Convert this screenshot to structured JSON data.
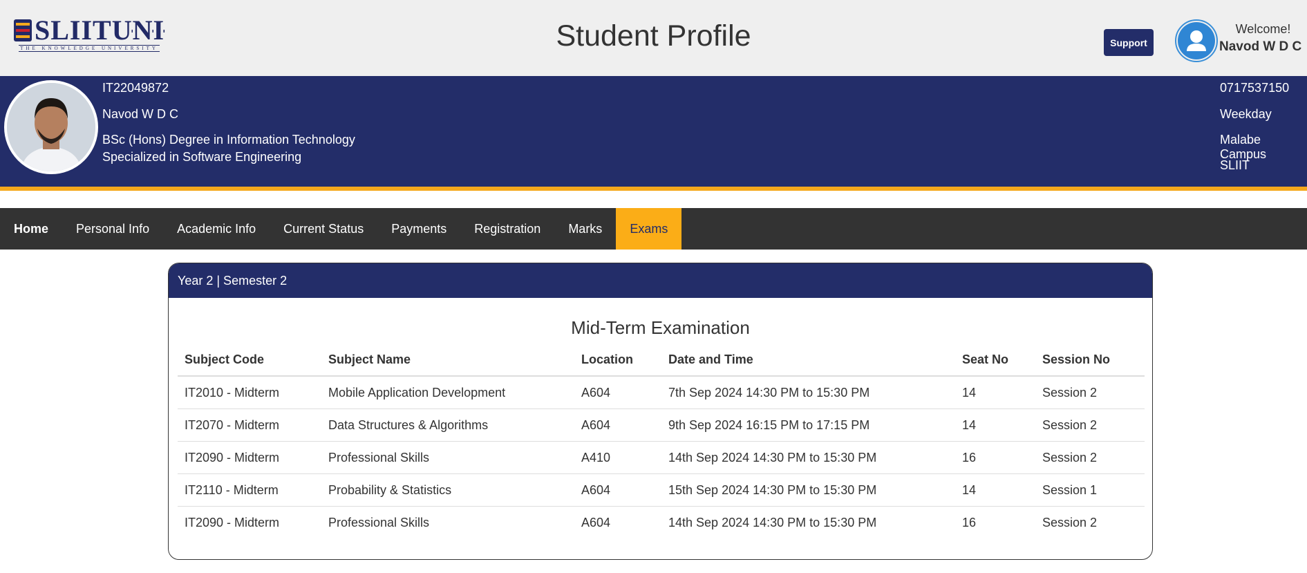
{
  "brand": {
    "logo_text": "SLIIT",
    "logo_uni": "UNI",
    "logo_tagline": "THE KNOWLEDGE UNIVERSITY"
  },
  "header": {
    "title": "Student Profile",
    "support_label": "Support",
    "welcome": "Welcome!",
    "user_name": "Navod W D C"
  },
  "profile": {
    "student_id": "IT22049872",
    "name": "Navod W D C",
    "degree_line1": "BSc (Hons) Degree in Information Technology",
    "degree_line2": "Specialized in Software Engineering",
    "phone": "0717537150",
    "batch_type": "Weekday",
    "campus": "Malabe Campus",
    "institute": "SLIIT"
  },
  "nav": {
    "items": [
      {
        "label": "Home"
      },
      {
        "label": "Personal Info"
      },
      {
        "label": "Academic Info"
      },
      {
        "label": "Current Status"
      },
      {
        "label": "Payments"
      },
      {
        "label": "Registration"
      },
      {
        "label": "Marks"
      },
      {
        "label": "Exams"
      }
    ],
    "active": "Exams"
  },
  "card": {
    "semester": "Year 2 | Semester 2",
    "exam_title": "Mid-Term Examination",
    "columns": [
      "Subject Code",
      "Subject Name",
      "Location",
      "Date and Time",
      "Seat No",
      "Session No"
    ],
    "rows": [
      [
        "IT2010 - Midterm",
        "Mobile Application Development",
        "A604",
        "7th Sep 2024 14:30 PM to 15:30 PM",
        "14",
        "Session 2"
      ],
      [
        "IT2070 - Midterm",
        "Data Structures & Algorithms",
        "A604",
        "9th Sep 2024 16:15 PM to 17:15 PM",
        "14",
        "Session 2"
      ],
      [
        "IT2090 - Midterm",
        "Professional Skills",
        "A410",
        "14th Sep 2024 14:30 PM to 15:30 PM",
        "16",
        "Session 2"
      ],
      [
        "IT2110 - Midterm",
        "Probability & Statistics",
        "A604",
        "15th Sep 2024 14:30 PM to 15:30 PM",
        "14",
        "Session 1"
      ],
      [
        "IT2090 - Midterm",
        "Professional Skills",
        "A604",
        "14th Sep 2024 14:30 PM to 15:30 PM",
        "16",
        "Session 2"
      ]
    ]
  },
  "colors": {
    "primary": "#232d69",
    "accent": "#fbad17",
    "nav_bg": "#333333",
    "header_bg": "#efefef"
  },
  "icons": {
    "user": "user-icon",
    "profile_photo": "student-photo"
  }
}
